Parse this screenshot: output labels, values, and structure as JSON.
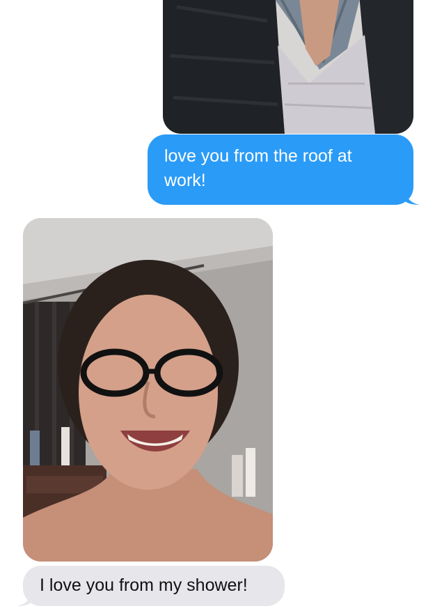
{
  "thread": {
    "sent_photo": {
      "icon": "selfie-photo",
      "description": ""
    },
    "sent_message": {
      "text": "love you from the roof at work!",
      "color": "#2a9bf7"
    },
    "received_photo": {
      "icon": "selfie-photo"
    },
    "received_message": {
      "text": "I love you from my shower!",
      "color": "#e6e6eb"
    }
  }
}
